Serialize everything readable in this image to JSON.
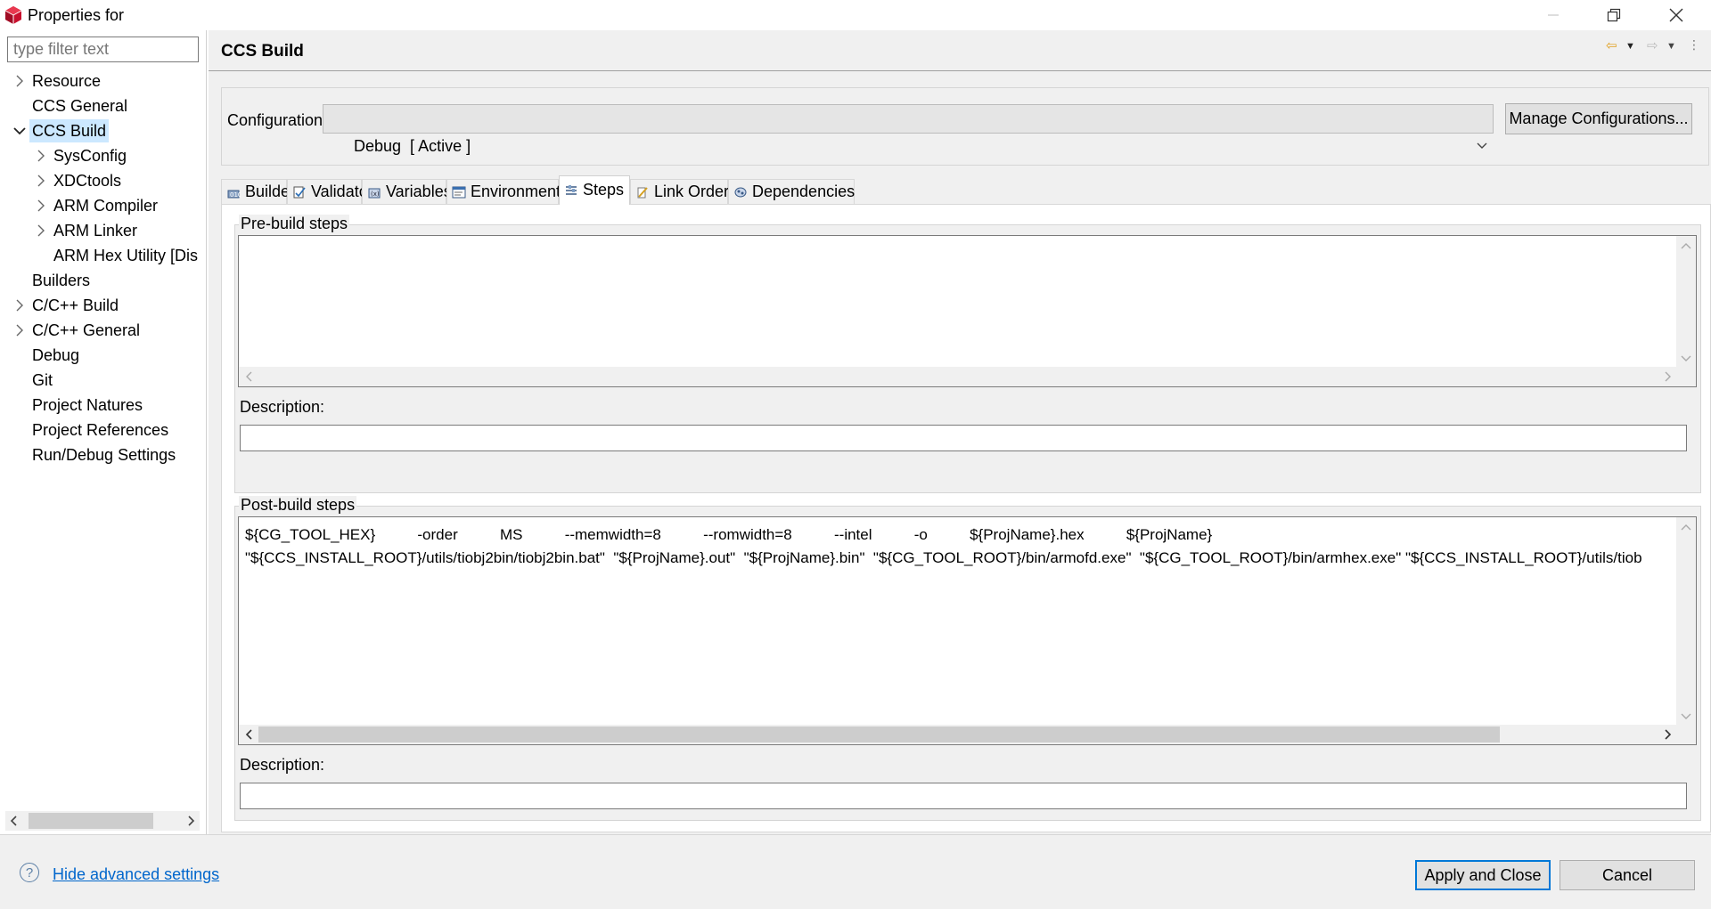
{
  "window": {
    "title": "Properties for",
    "icon": "ccs-cube-icon",
    "buttons": [
      "minimize",
      "restore",
      "close"
    ]
  },
  "filter": {
    "placeholder": "type filter text",
    "value": ""
  },
  "tree": {
    "items": [
      {
        "label": "Resource",
        "level": 0,
        "expandable": true,
        "expanded": false
      },
      {
        "label": "CCS General",
        "level": 0,
        "expandable": false
      },
      {
        "label": "CCS Build",
        "level": 0,
        "expandable": true,
        "expanded": true,
        "selected": true
      },
      {
        "label": "SysConfig",
        "level": 1,
        "expandable": true,
        "expanded": false
      },
      {
        "label": "XDCtools",
        "level": 1,
        "expandable": true,
        "expanded": false
      },
      {
        "label": "ARM Compiler",
        "level": 1,
        "expandable": true,
        "expanded": false
      },
      {
        "label": "ARM Linker",
        "level": 1,
        "expandable": true,
        "expanded": false
      },
      {
        "label": "ARM Hex Utility  [Dis",
        "level": 1,
        "expandable": false
      },
      {
        "label": "Builders",
        "level": 0,
        "expandable": false
      },
      {
        "label": "C/C++ Build",
        "level": 0,
        "expandable": true,
        "expanded": false
      },
      {
        "label": "C/C++ General",
        "level": 0,
        "expandable": true,
        "expanded": false
      },
      {
        "label": "Debug",
        "level": 0,
        "expandable": false
      },
      {
        "label": "Git",
        "level": 0,
        "expandable": false
      },
      {
        "label": "Project Natures",
        "level": 0,
        "expandable": false
      },
      {
        "label": "Project References",
        "level": 0,
        "expandable": false
      },
      {
        "label": "Run/Debug Settings",
        "level": 0,
        "expandable": false
      }
    ]
  },
  "page": {
    "title": "CCS Build",
    "configuration_label": "Configuration:",
    "configuration_value": "Debug  [ Active ]",
    "manage_button": "Manage Configurations..."
  },
  "tabs": [
    {
      "label": "Builder",
      "icon": "builder-icon",
      "active": false
    },
    {
      "label": "Validator",
      "icon": "validator-icon",
      "active": false
    },
    {
      "label": "Variables",
      "icon": "variables-icon",
      "active": false
    },
    {
      "label": "Environment",
      "icon": "environment-icon",
      "active": false
    },
    {
      "label": "Steps",
      "icon": "steps-icon",
      "active": true
    },
    {
      "label": "Link Order",
      "icon": "link-order-icon",
      "active": false
    },
    {
      "label": "Dependencies",
      "icon": "dependencies-icon",
      "active": false
    }
  ],
  "prebuild": {
    "title": "Pre-build steps",
    "commands": "",
    "description_label": "Description:",
    "description_value": ""
  },
  "postbuild": {
    "title": "Post-build steps",
    "command_line_1": "${CG_TOOL_HEX}          -order          MS          --memwidth=8          --romwidth=8          --intel          -o          ${ProjName}.hex          ${ProjName}",
    "command_line_2": "\"${CCS_INSTALL_ROOT}/utils/tiobj2bin/tiobj2bin.bat\"  \"${ProjName}.out\"  \"${ProjName}.bin\"  \"${CG_TOOL_ROOT}/bin/armofd.exe\"  \"${CG_TOOL_ROOT}/bin/armhex.exe\" \"${CCS_INSTALL_ROOT}/utils/tiob",
    "description_label": "Description:",
    "description_value": ""
  },
  "footer": {
    "help_link": "Hide advanced settings",
    "apply_button": "Apply and Close",
    "cancel_button": "Cancel"
  },
  "colors": {
    "selection": "#cce8ff",
    "link": "#0066cc",
    "default_button_border": "#0078d7",
    "dialog_background": "#f0f0f0"
  }
}
